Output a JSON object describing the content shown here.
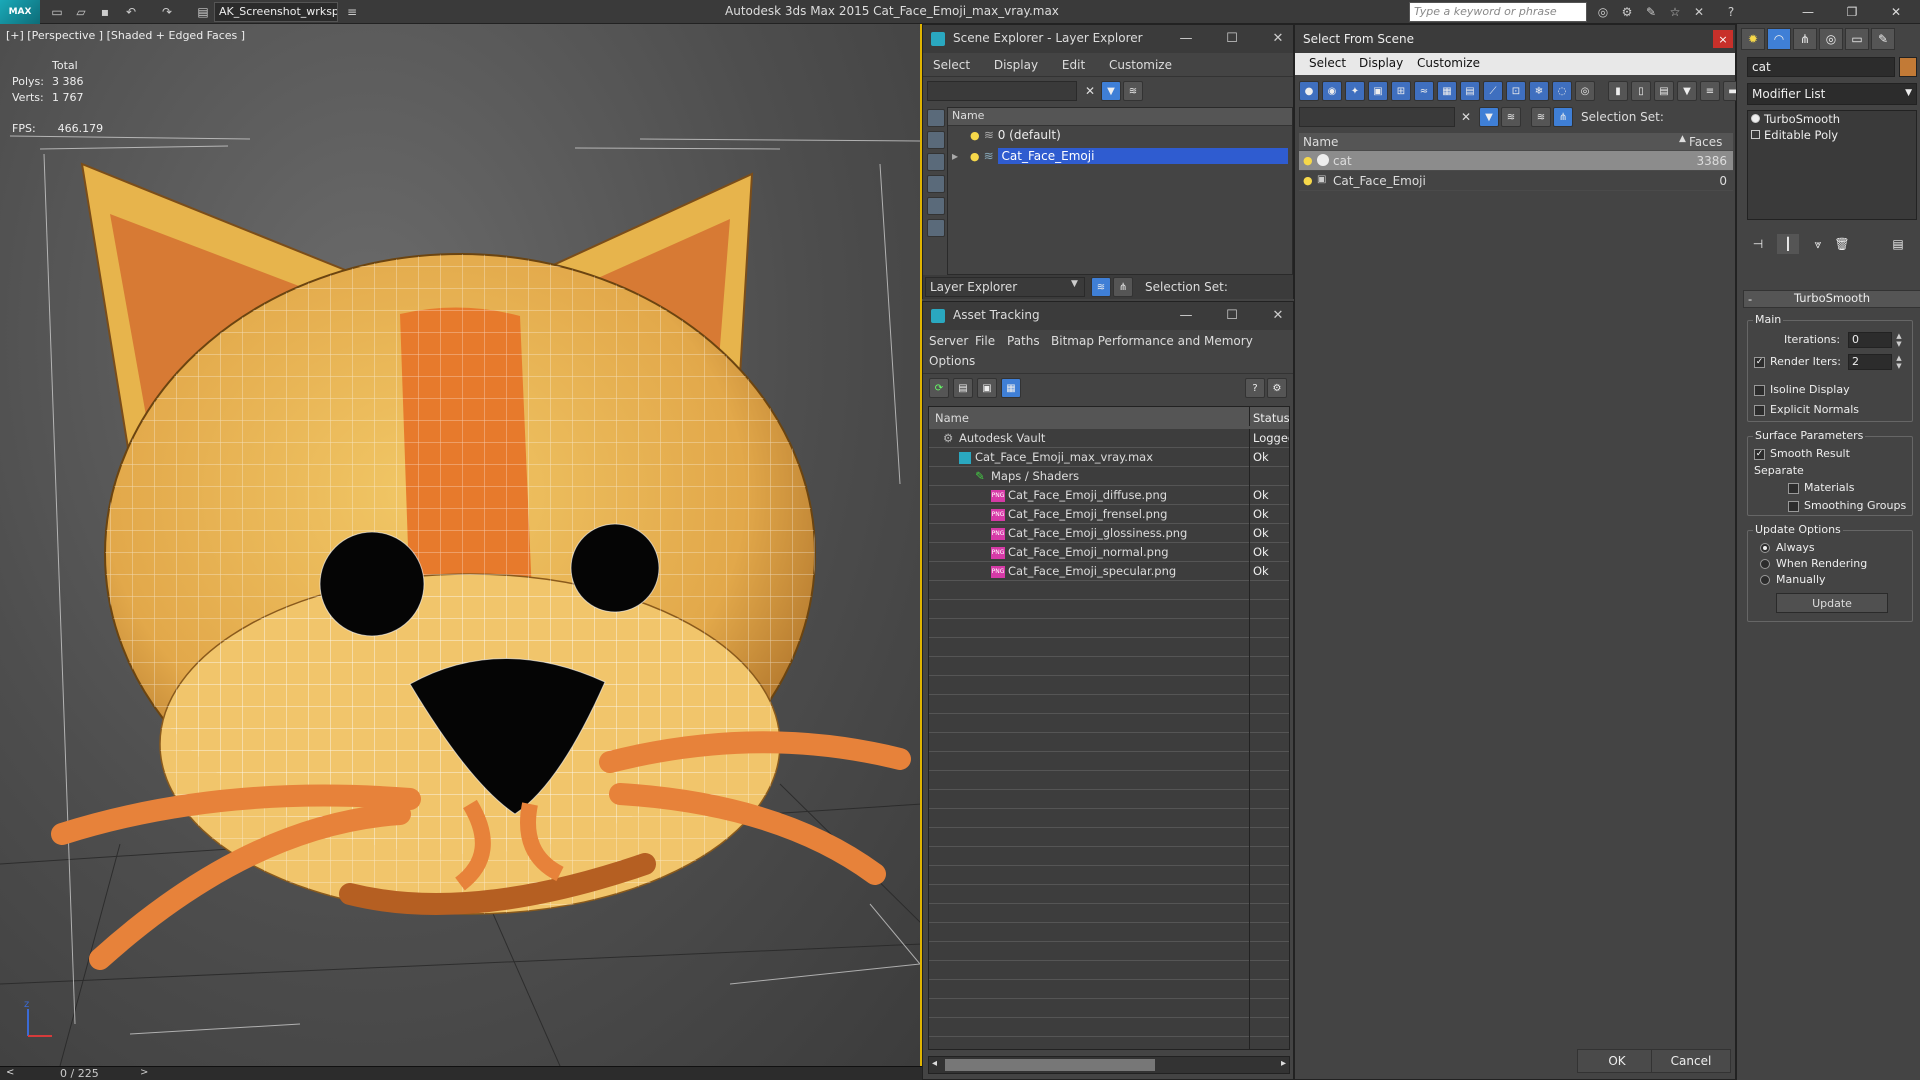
{
  "titlebar": {
    "logo": "MAX",
    "workspace": "AK_Screenshot_wrksp",
    "app_title": "Autodesk 3ds Max  2015     Cat_Face_Emoji_max_vray.max",
    "search_placeholder": "Type a keyword or phrase"
  },
  "viewport": {
    "label": "[+] [Perspective ] [Shaded + Edged Faces ]",
    "stats_header": "Total",
    "polys_label": "Polys:",
    "polys_value": "3 386",
    "verts_label": "Verts:",
    "verts_value": "1 767",
    "fps_label": "FPS:",
    "fps_value": "466.179",
    "axis_z": "z"
  },
  "timeline": {
    "counter": "0 / 225",
    "next": ">",
    "prev": "<"
  },
  "scene_explorer": {
    "title": "Scene Explorer - Layer Explorer",
    "menu": [
      "Select",
      "Display",
      "Edit",
      "Customize"
    ],
    "column_name": "Name",
    "layers": [
      "0 (default)",
      "Cat_Face_Emoji"
    ],
    "footer_dropdown": "Layer Explorer",
    "selection_set_label": "Selection Set:"
  },
  "asset_tracking": {
    "title": "Asset Tracking",
    "menu": [
      "Server",
      "File",
      "Paths",
      "Bitmap Performance and Memory",
      "Options"
    ],
    "col_name": "Name",
    "col_status": "Status",
    "rows": [
      {
        "name": "Autodesk Vault",
        "status": "Logged",
        "indent": 0,
        "icon": "vault"
      },
      {
        "name": "Cat_Face_Emoji_max_vray.max",
        "status": "Ok",
        "indent": 1,
        "icon": "max"
      },
      {
        "name": "Maps / Shaders",
        "status": "",
        "indent": 2,
        "icon": "maps"
      },
      {
        "name": "Cat_Face_Emoji_diffuse.png",
        "status": "Ok",
        "indent": 3,
        "icon": "png"
      },
      {
        "name": "Cat_Face_Emoji_frensel.png",
        "status": "Ok",
        "indent": 3,
        "icon": "png"
      },
      {
        "name": "Cat_Face_Emoji_glossiness.png",
        "status": "Ok",
        "indent": 3,
        "icon": "png"
      },
      {
        "name": "Cat_Face_Emoji_normal.png",
        "status": "Ok",
        "indent": 3,
        "icon": "png"
      },
      {
        "name": "Cat_Face_Emoji_specular.png",
        "status": "Ok",
        "indent": 3,
        "icon": "png"
      }
    ],
    "png_tag": "PNG"
  },
  "select_from_scene": {
    "title": "Select From Scene",
    "close": "×",
    "menu": [
      "Select",
      "Display",
      "Customize"
    ],
    "selection_set_label": "Selection Set:",
    "col_name": "Name",
    "col_faces": "Faces",
    "rows": [
      {
        "name": "cat",
        "faces": "3386",
        "selected": true
      },
      {
        "name": "Cat_Face_Emoji",
        "faces": "0",
        "selected": false
      }
    ],
    "ok": "OK",
    "cancel": "Cancel"
  },
  "command_panel": {
    "object_name": "cat",
    "modifier_list": "Modifier List",
    "stack": [
      "TurboSmooth",
      "Editable Poly"
    ],
    "turbosmooth": {
      "header": "TurboSmooth",
      "collapse": "-",
      "main": "Main",
      "iterations_label": "Iterations:",
      "iterations_value": "0",
      "render_iters_label": "Render Iters:",
      "render_iters_value": "2",
      "isoline": "Isoline Display",
      "explicit_normals": "Explicit Normals",
      "surface_params": "Surface Parameters",
      "smooth_result": "Smooth Result",
      "separate": "Separate",
      "materials": "Materials",
      "smoothing_groups": "Smoothing Groups",
      "update_options": "Update Options",
      "always": "Always",
      "when_rendering": "When Rendering",
      "manually": "Manually",
      "update_button": "Update"
    }
  },
  "colors": {
    "cat_body": "#e9b24e",
    "cat_stripe": "#e77a2c",
    "selection_blue": "#2f5cd0",
    "viewport_border": "#e0b400"
  }
}
